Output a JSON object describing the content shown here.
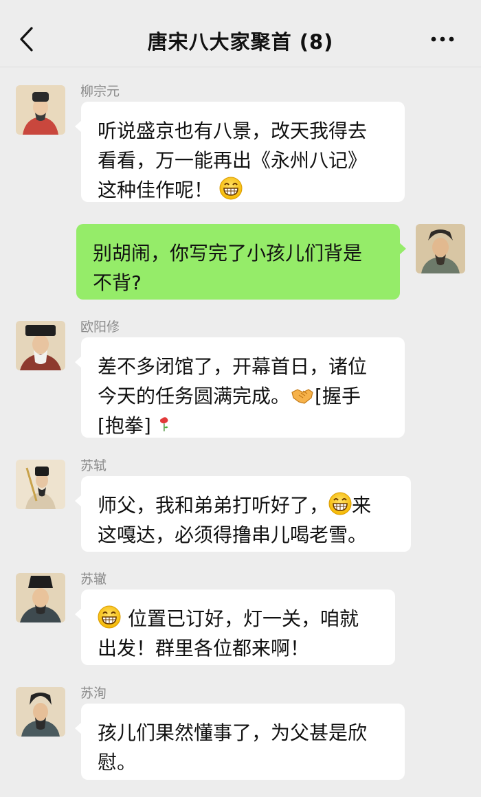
{
  "header": {
    "title": "唐宋八大家聚首 (8)",
    "back_icon": "back-chevron-icon",
    "more_icon": "more-dots-icon"
  },
  "messages": [
    {
      "sender": "柳宗元",
      "side": "left",
      "lines": [
        "听说盛京也有八景，改天我得去",
        "看看，万一能再出《永州八记》",
        "这种佳作呢！"
      ],
      "emoji": "grin-emoji"
    },
    {
      "sender": "",
      "side": "right",
      "lines": [
        "别胡闹，你写完了小孩儿们背是",
        "不背?"
      ]
    },
    {
      "sender": "欧阳修",
      "side": "left",
      "lines": [
        "差不多闭馆了，开幕首日，诸位",
        "今天的任务圆满完成。",
        "[握手",
        "[抱拳]"
      ],
      "emoji": [
        "handshake-emoji",
        "rose-emoji"
      ]
    },
    {
      "sender": "苏轼",
      "side": "left",
      "lines": [
        "师父，我和弟弟打听好了，",
        "来",
        "这嘎达，必须得撸串儿喝老雪。"
      ],
      "emoji": "grin-emoji"
    },
    {
      "sender": "苏辙",
      "side": "left",
      "lines": [
        "位置已订好，灯一关，咱就",
        "出发！群里各位都来啊！"
      ],
      "emoji": "grin-emoji"
    },
    {
      "sender": "苏洵",
      "side": "left",
      "lines": [
        "孩儿们果然懂事了，为父甚是欣",
        "慰。"
      ]
    }
  ],
  "colors": {
    "background": "#ededed",
    "incoming_bubble": "#ffffff",
    "outgoing_bubble": "#95ec69",
    "sender_name": "#8a8a8a"
  }
}
